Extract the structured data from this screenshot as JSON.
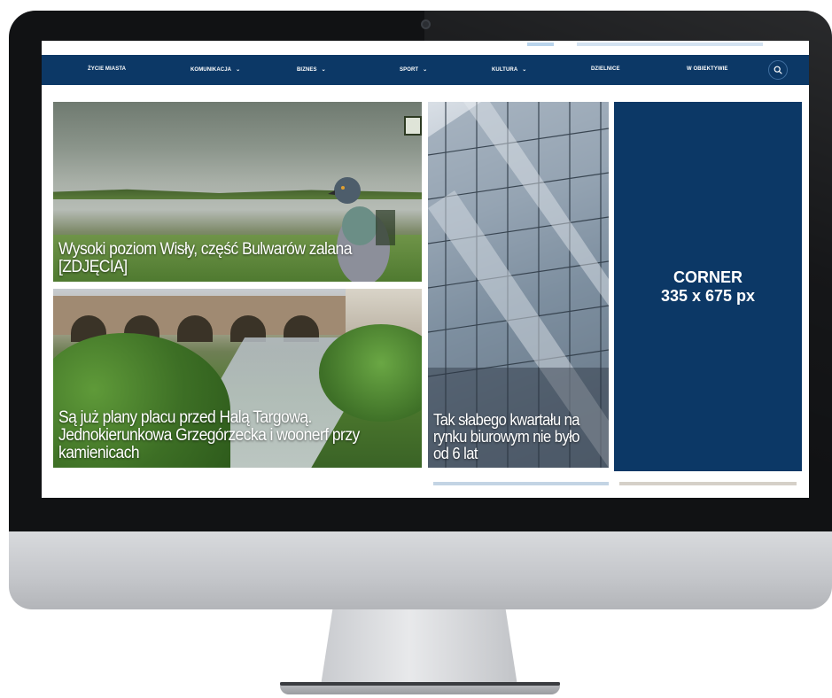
{
  "nav": {
    "items": [
      {
        "label": "Życie miasta",
        "dropdown": false
      },
      {
        "label": "Komunikacja",
        "dropdown": true
      },
      {
        "label": "Biznes",
        "dropdown": true
      },
      {
        "label": "Sport",
        "dropdown": true
      },
      {
        "label": "Kultura",
        "dropdown": true
      },
      {
        "label": "Dzielnice",
        "dropdown": false
      },
      {
        "label": "W obiektywie",
        "dropdown": false
      }
    ],
    "search_icon": "search-icon"
  },
  "articles": [
    {
      "title": "Wysoki poziom Wisły, część Bulwarów zalana [ZDJĘCIA]"
    },
    {
      "title": "Są już plany placu przed Halą Targową. Jednokierunkowa Grzegórzecka i woonerf przy kamienicach"
    },
    {
      "title": "Tak słabego kwartału na rynku biurowym nie było od 6 lat"
    }
  ],
  "ad": {
    "line1": "CORNER",
    "line2": "335 x 675 px"
  },
  "colors": {
    "nav_bg": "#0c3866",
    "ad_bg": "#0c3866",
    "accent_light": "#b9d4ec"
  }
}
